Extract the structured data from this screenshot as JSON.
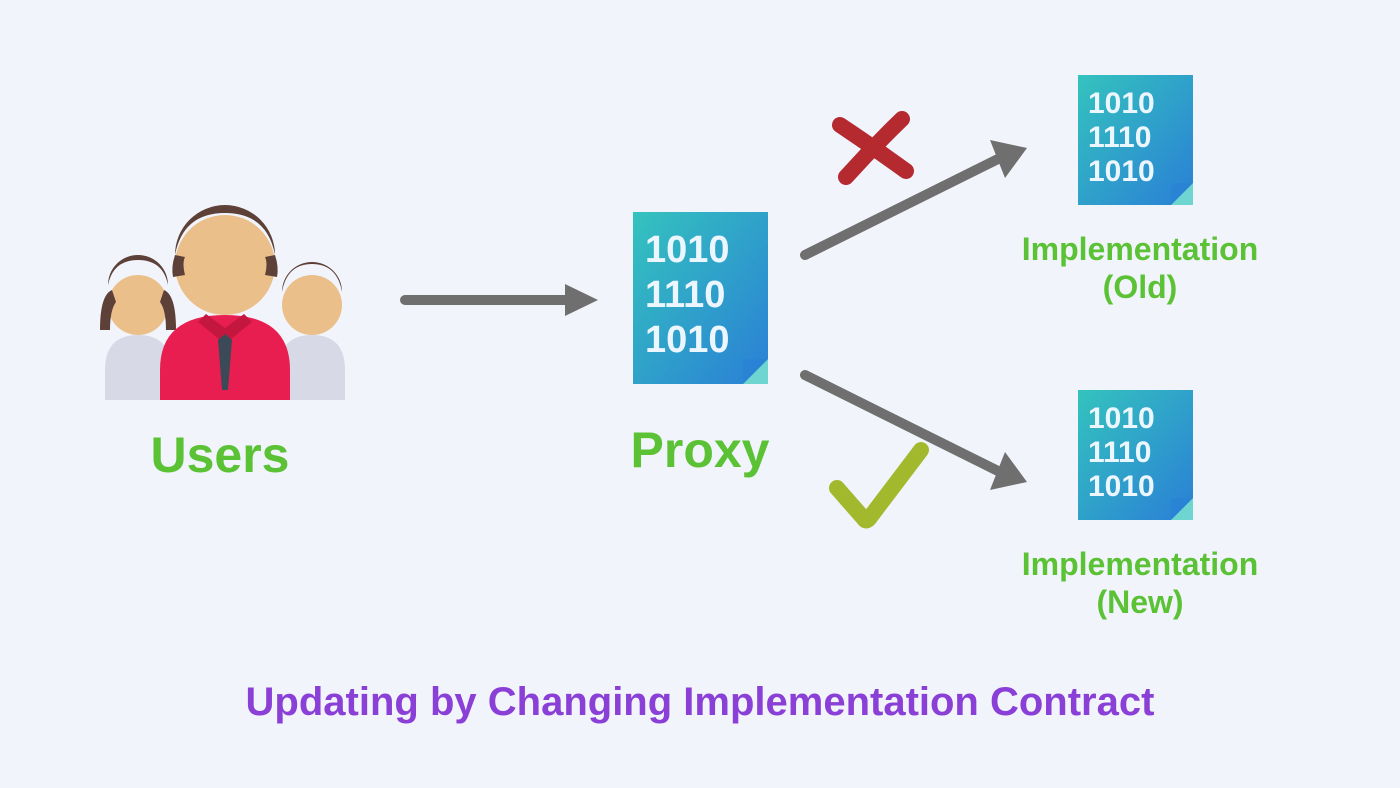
{
  "labels": {
    "users": "Users",
    "proxy": "Proxy",
    "impl_old_line1": "Implementation",
    "impl_old_line2": "(Old)",
    "impl_new_line1": "Implementation",
    "impl_new_line2": "(New)"
  },
  "caption": "Updating by Changing Implementation Contract",
  "binary": {
    "r1": "1010",
    "r2": "1110",
    "r3": "1010"
  },
  "colors": {
    "bg": "#f2f4fc",
    "label_green": "#5bc236",
    "caption_purple": "#8a3fd6",
    "arrow_gray": "#6f6f6f",
    "x_red": "#c1272d",
    "check_green": "#a2b92e",
    "doc_cyan": "#2fb9c8",
    "doc_blue": "#2a7fd6",
    "user_skin": "#eabf8a",
    "user_hair": "#5d4037",
    "user_shirt_center": "#e91e50",
    "user_shirt_side": "#d7d9e6",
    "user_tie": "#3b4a56"
  }
}
